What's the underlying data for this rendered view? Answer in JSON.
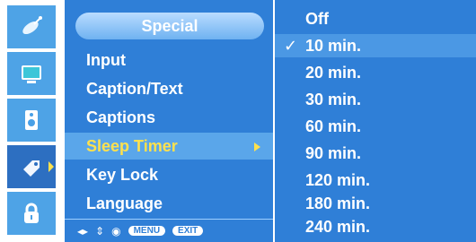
{
  "menu": {
    "title": "Special",
    "items": [
      {
        "label": "Input"
      },
      {
        "label": "Caption/Text"
      },
      {
        "label": "Captions"
      },
      {
        "label": "Sleep Timer"
      },
      {
        "label": "Key Lock"
      },
      {
        "label": "Language"
      }
    ],
    "selected_label": "Sleep Timer",
    "bottom_controls": {
      "menu": "MENU",
      "exit": "EXIT"
    }
  },
  "submenu": {
    "items": [
      {
        "label": "Off"
      },
      {
        "label": "10 min."
      },
      {
        "label": "20 min."
      },
      {
        "label": "30 min."
      },
      {
        "label": "60 min."
      },
      {
        "label": "90 min."
      },
      {
        "label": "120 min."
      },
      {
        "label": "180 min."
      },
      {
        "label": "240 min."
      }
    ],
    "checked_label": "10 min."
  },
  "sidebar": {
    "icons": [
      "satellite-dish-icon",
      "screen-icon",
      "speaker-icon",
      "tag-icon",
      "lock-icon"
    ],
    "active_icon": "tag-icon"
  },
  "colors": {
    "menu_bg": "#2f7fd7",
    "selected_text": "#ffe14d",
    "selected_bg": "#5aa6ea"
  }
}
